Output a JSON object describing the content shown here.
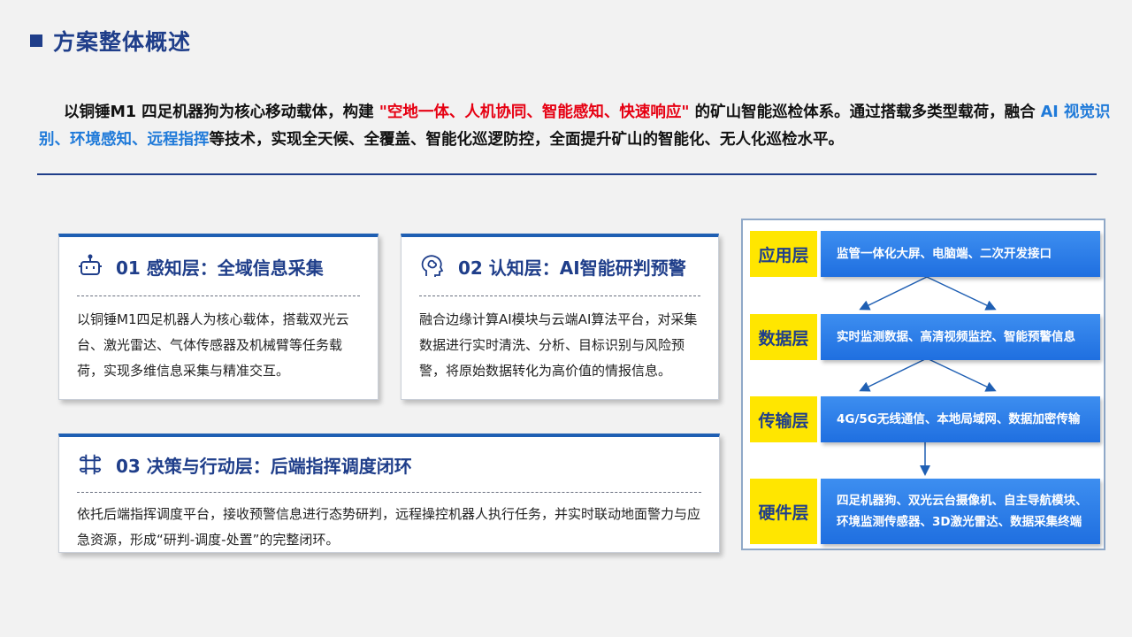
{
  "header": {
    "title": "方案整体概述"
  },
  "intro": {
    "p1": "以铜锤M1 四足机器狗为核心移动载体，构建 ",
    "highlight_red": "\"空地一体、人机协同、智能感知、快速响应\"",
    "p2": " 的矿山智能巡检体系。通过搭载多类型载荷，融合 ",
    "highlight_blue": "AI 视觉识别、环境感知、远程指挥",
    "p3": "等技术，实现全天候、全覆盖、智能化巡逻防控，全面提升矿山的智能化、无人化巡检水平。"
  },
  "cards": [
    {
      "title": "01 感知层：全域信息采集",
      "body": "以铜锤M1四足机器人为核心载体，搭载双光云台、激光雷达、气体传感器及机械臂等任务载荷，实现多维信息采集与精准交互。",
      "icon": "robot-icon"
    },
    {
      "title": "02 认知层：AI智能研判预警",
      "body": "融合边缘计算AI模块与云端AI算法平台，对采集数据进行实时清洗、分析、目标识别与风险预警，将原始数据转化为高价值的情报信息。",
      "icon": "brain-icon"
    },
    {
      "title": "03 决策与行动层：后端指挥调度闭环",
      "body": "依托后端指挥调度平台，接收预警信息进行态势研判，远程操控机器人执行任务，并实时联动地面警力与应急资源，形成“研判-调度-处置”的完整闭环。",
      "icon": "command-icon"
    }
  ],
  "architecture": {
    "layers": [
      {
        "label": "应用层",
        "content": "监管一体化大屏、电脑端、二次开发接口"
      },
      {
        "label": "数据层",
        "content": "实时监测数据、高清视频监控、智能预警信息"
      },
      {
        "label": "传输层",
        "content": "4G/5G无线通信、本地局域网、数据加密传输"
      },
      {
        "label": "硬件层",
        "content_line1": "四足机器狗、双光云台摄像机、自主导航模块、",
        "content_line2": "环境监测传感器、3D激光雷达、数据采集终端"
      }
    ],
    "colors": {
      "label_bg": "#ffe600",
      "box_bg": "#2a7be6",
      "label_text": "#1f3e8a"
    }
  },
  "colors": {
    "accent": "#1f3e8a",
    "red": "#e60012",
    "blue": "#1f7ad9"
  }
}
